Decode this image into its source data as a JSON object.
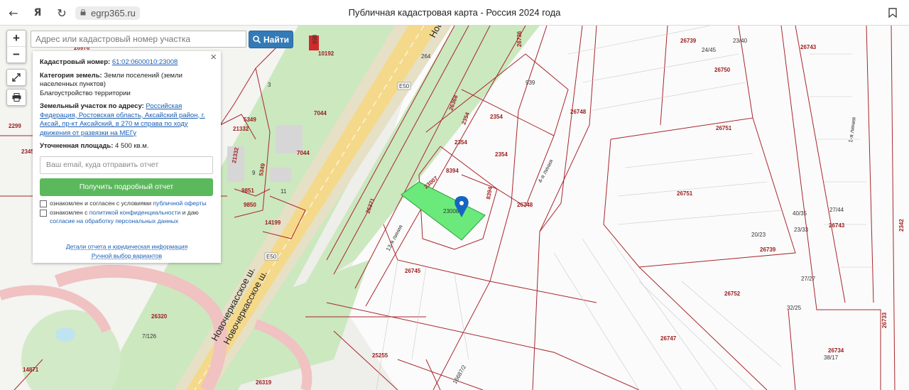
{
  "browser": {
    "url": "egrp365.ru",
    "title": "Публичная кадастровая карта - Россия 2024 года"
  },
  "search": {
    "placeholder": "Адрес или кадастровый номер участка",
    "button_label": "Найти"
  },
  "map_controls": {
    "zoom_in": "+",
    "zoom_out": "−"
  },
  "info_panel": {
    "close": "×",
    "cadastral_label": "Кадастровый номер:",
    "cadastral_value": "61:02:0600010:23008",
    "category_label": "Категория земель:",
    "category_value": "Земли поселений (земли населенных пунктов)",
    "category_extra": "Благоустройство территории",
    "address_label": "Земельный участок по адресу:",
    "address_value": "Российская Федерация, Ростовская область, Аксайский район, г. Аксай, пр-кт Аксайский, в 270 м справа по ходу движения от развязки на МЕГу",
    "area_label": "Уточненная площадь:",
    "area_value": "4 500 кв.м.",
    "email_placeholder": "Ваш email, куда отправить отчет",
    "report_button": "Получить подробный отчет",
    "consent1_text": "ознакомлен и согласен с условиями",
    "consent1_link": "публичной оферты",
    "consent2_text": "ознакомлен с",
    "consent2_link": "политикой конфиденциальности",
    "consent2_text2": "и даю",
    "consent2_link2": "согласие на обработку персональных данных",
    "link_details": "Детали отчета и юридическая информация",
    "link_manual": "Ручной выбор вариантов"
  },
  "map_labels": {
    "selected_parcel": "23008",
    "road_e50_a": "E50",
    "road_e50_b": "E50",
    "road_novocherkassk_1": "Новочеркасское ш.",
    "road_novocherkassk_2": "Новочеркасское ш.",
    "road_novo_top": "Ново",
    "street_4": "4-я линия",
    "street_13": "13-я линия",
    "street_1": "1-я линия",
    "parcels": [
      "26976",
      "10192",
      "898",
      "264",
      "3",
      "7044",
      "7044",
      "5349",
      "21332",
      "21332",
      "9",
      "5349",
      "9851",
      "9850",
      "11",
      "14199",
      "2299",
      "2345",
      "26371",
      "26368",
      "2354",
      "2354",
      "2354",
      "2354",
      "8394",
      "8394",
      "23007",
      "939",
      "26748",
      "26748",
      "26736",
      "26739",
      "26743",
      "24/45",
      "23/40",
      "26750",
      "26751",
      "26751",
      "26745",
      "26739",
      "26747",
      "26752",
      "26734",
      "26733",
      "26743",
      "26320",
      "26319",
      "25255",
      "14871",
      "16687/2",
      "7/126",
      "2342",
      "40/35",
      "20/23",
      "27/44",
      "23/33",
      "32/25",
      "27/27",
      "38/17"
    ]
  },
  "colors": {
    "selected_fill": "#6bea7b",
    "parcel_border": "#a8262c",
    "park_green": "#c8e6bd",
    "road_yellow": "#f5d98a",
    "ring_pink": "#f2c9c9"
  }
}
